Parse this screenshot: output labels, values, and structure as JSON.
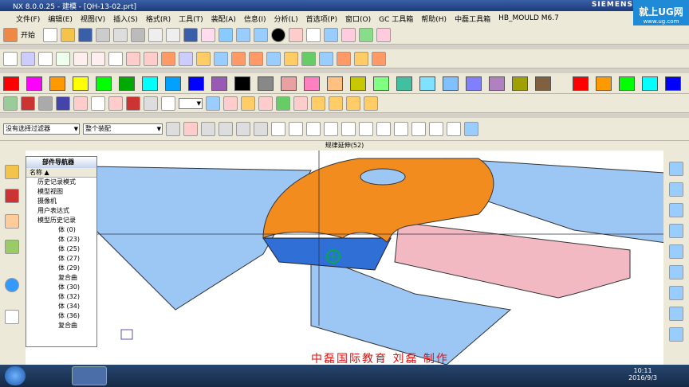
{
  "window": {
    "title": "NX 8.0.0.25 - 建模 - [QH-13-02.prt]",
    "brand": "SIEMENS"
  },
  "logo": {
    "text": "就上UG网",
    "sub": "www.ug.com"
  },
  "menu": [
    "文件(F)",
    "编辑(E)",
    "视图(V)",
    "插入(S)",
    "格式(R)",
    "工具(T)",
    "装配(A)",
    "信息(I)",
    "分析(L)",
    "首选项(P)",
    "窗口(O)",
    "GC 工具箱",
    "帮助(H)",
    "中磊工具箱",
    "HB_MOULD M6.7"
  ],
  "toolbar1": {
    "start_label": "开始"
  },
  "colors": [
    "#ff0000",
    "#ff00ff",
    "#ff9900",
    "#ffff00",
    "#00ff00",
    "#00aa00",
    "#00ffff",
    "#00a0ff",
    "#0000ff",
    "#9b59b6",
    "#000000",
    "#888888",
    "#e8a0a0",
    "#ff80c0",
    "#ffc080",
    "#c8c800",
    "#80ff80",
    "#40c0a0",
    "#80e0ff",
    "#80c0ff",
    "#8080ff",
    "#b080c0",
    "#a0a000",
    "#806040",
    "#ff0000",
    "#ff9900",
    "#00ff00",
    "#00ffff",
    "#0000ff"
  ],
  "filters": {
    "selection_filter": "没有选择过滤器",
    "assembly": "整个装配"
  },
  "command_status": "规律延伸(52)",
  "navigator": {
    "title": "部件导航器",
    "column": "名称",
    "rows": [
      "历史记录模式",
      "模型视图",
      "摄像机",
      "用户表达式",
      "模型历史记录",
      "体 (0)",
      "体 (23)",
      "体 (25)",
      "体 (27)",
      "体 (29)",
      "复合曲",
      "体 (30)",
      "体 (32)",
      "体 (34)",
      "体 (36)",
      "复合曲"
    ]
  },
  "watermark": "中磊国际教育    刘磊    制作",
  "taskbar": {
    "time": "10:11",
    "date": "2016/9/3"
  }
}
